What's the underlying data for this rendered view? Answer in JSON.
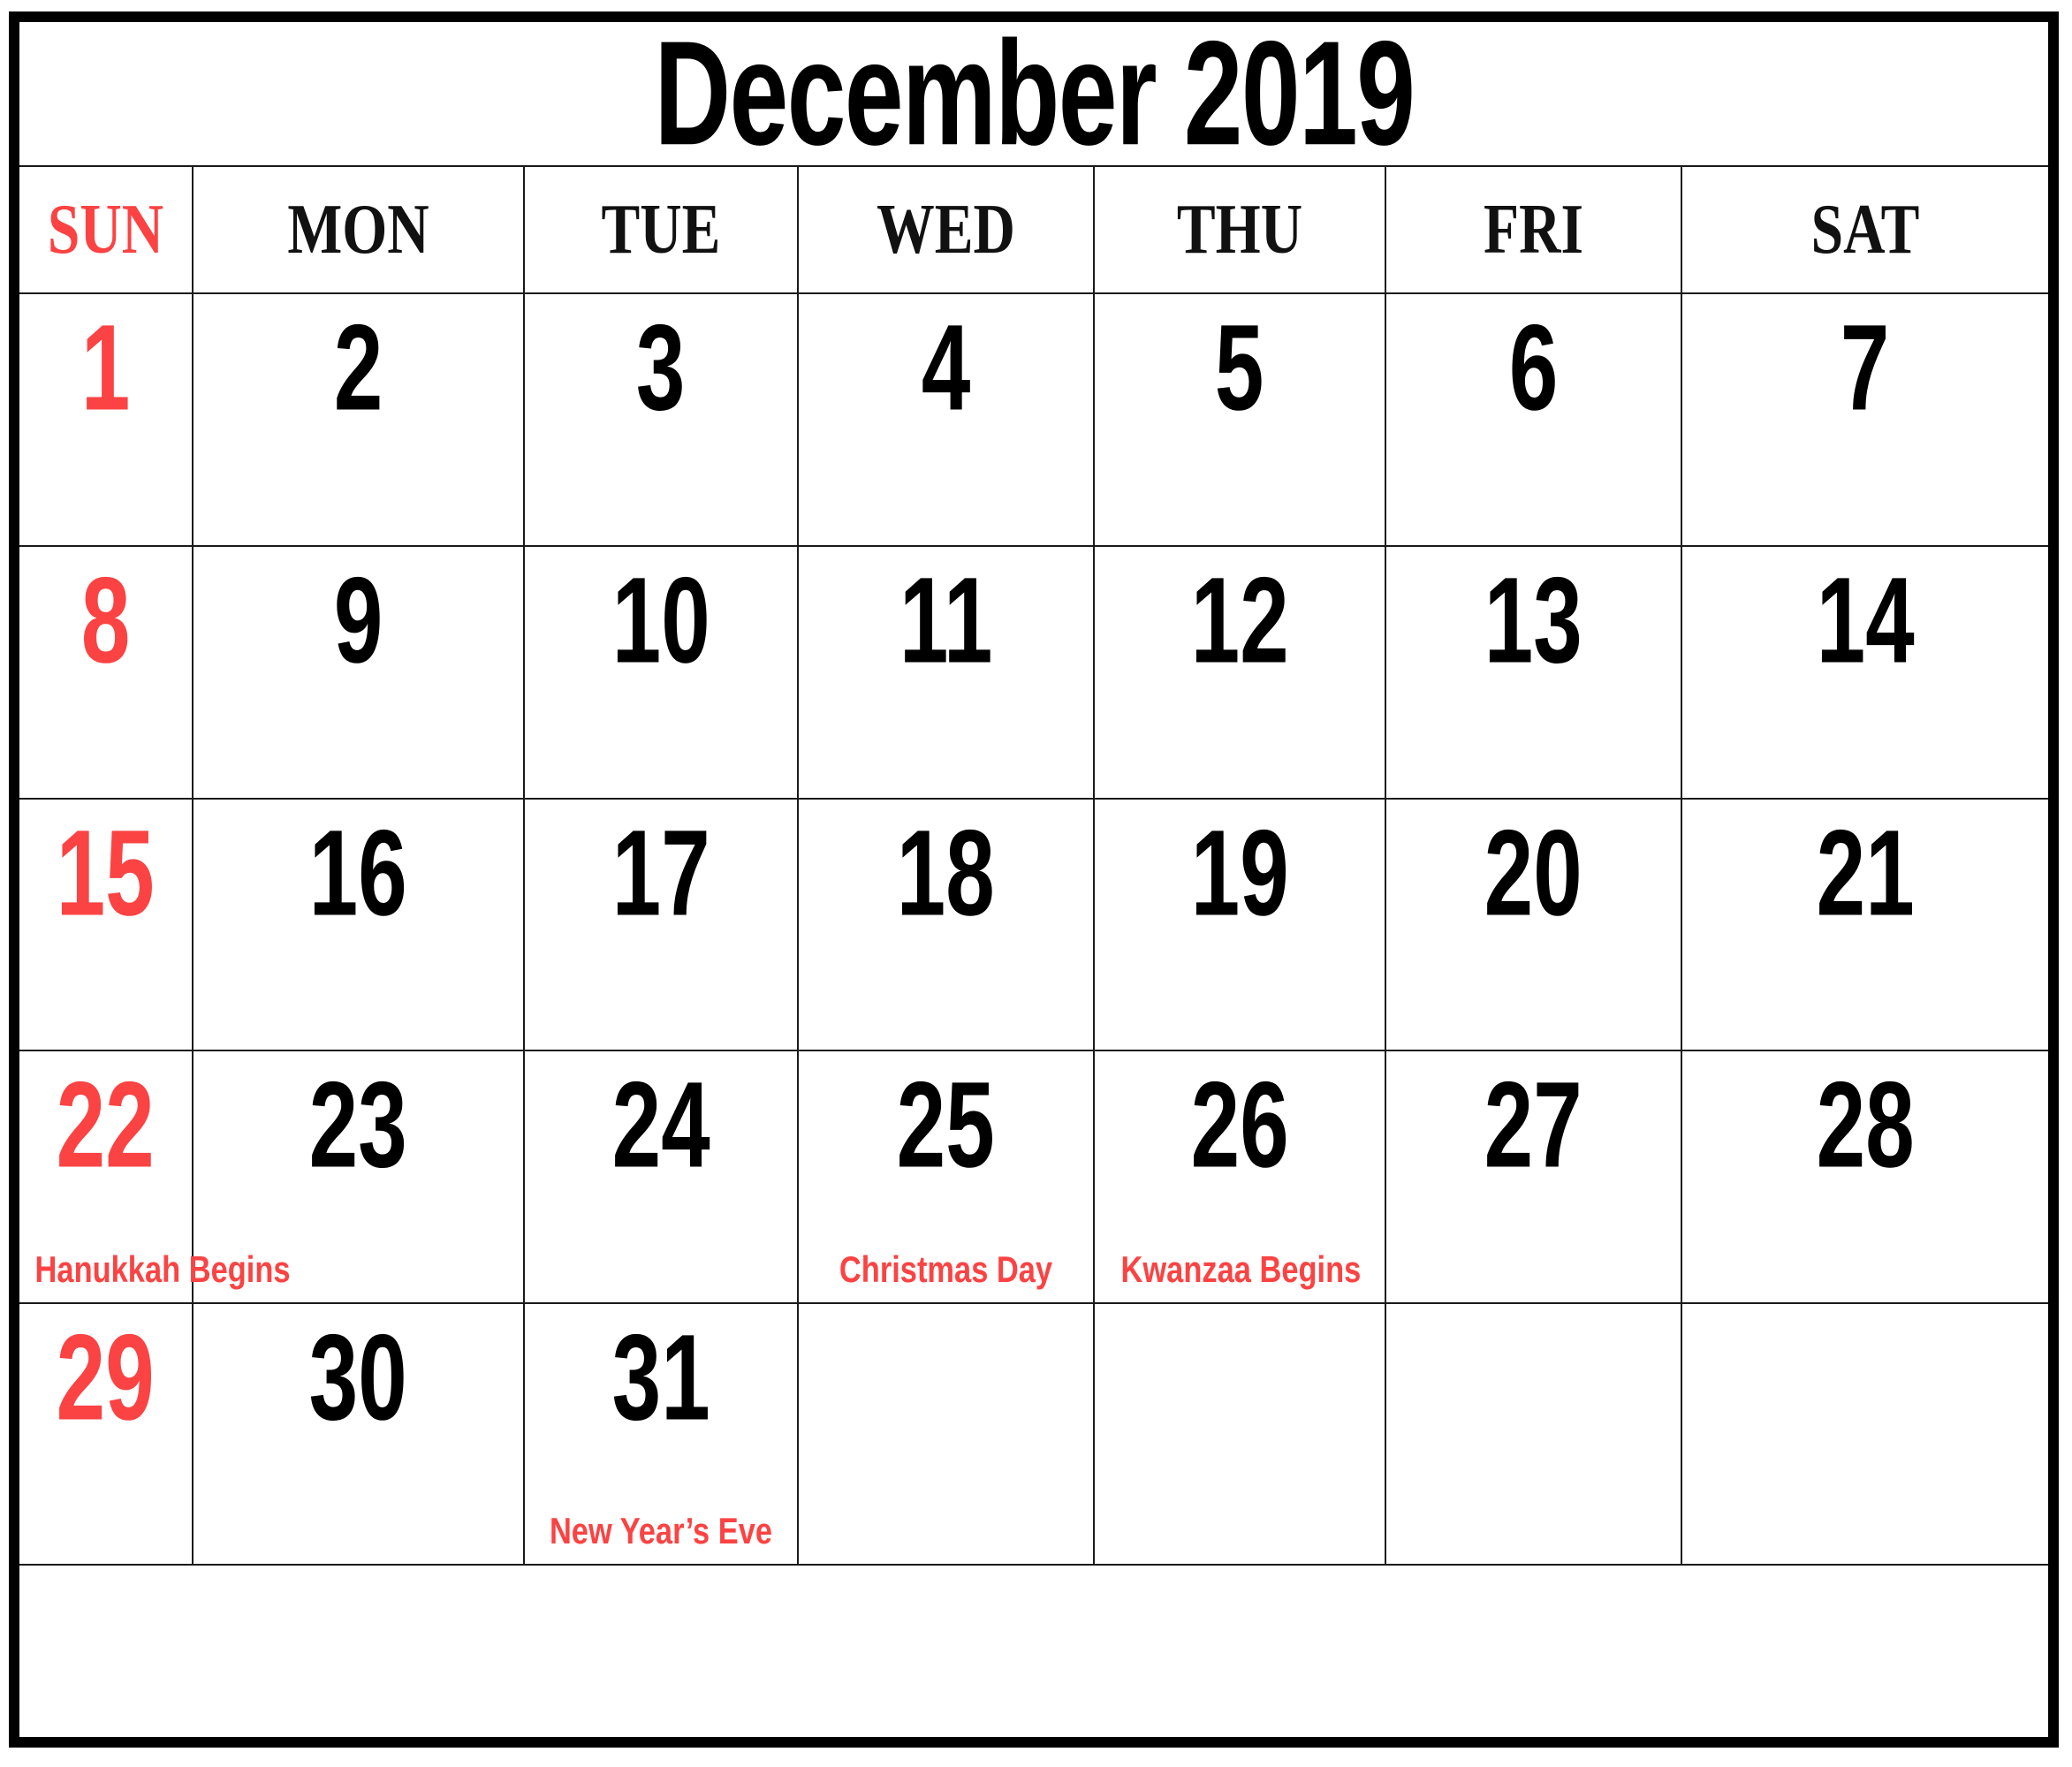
{
  "calendar": {
    "title": "December 2019",
    "accent_red": "#fb4343",
    "text_black": "#000000",
    "weekdays": [
      {
        "label": "SUN",
        "is_sunday": true
      },
      {
        "label": "MON",
        "is_sunday": false
      },
      {
        "label": "TUE",
        "is_sunday": false
      },
      {
        "label": "WED",
        "is_sunday": false
      },
      {
        "label": "THU",
        "is_sunday": false
      },
      {
        "label": "FRI",
        "is_sunday": false
      },
      {
        "label": "SAT",
        "is_sunday": false
      }
    ],
    "weeks": [
      [
        {
          "day": "1",
          "event": "",
          "is_sunday": true
        },
        {
          "day": "2",
          "event": "",
          "is_sunday": false
        },
        {
          "day": "3",
          "event": "",
          "is_sunday": false
        },
        {
          "day": "4",
          "event": "",
          "is_sunday": false
        },
        {
          "day": "5",
          "event": "",
          "is_sunday": false
        },
        {
          "day": "6",
          "event": "",
          "is_sunday": false
        },
        {
          "day": "7",
          "event": "",
          "is_sunday": false
        }
      ],
      [
        {
          "day": "8",
          "event": "",
          "is_sunday": true
        },
        {
          "day": "9",
          "event": "",
          "is_sunday": false
        },
        {
          "day": "10",
          "event": "",
          "is_sunday": false
        },
        {
          "day": "11",
          "event": "",
          "is_sunday": false
        },
        {
          "day": "12",
          "event": "",
          "is_sunday": false
        },
        {
          "day": "13",
          "event": "",
          "is_sunday": false
        },
        {
          "day": "14",
          "event": "",
          "is_sunday": false
        }
      ],
      [
        {
          "day": "15",
          "event": "",
          "is_sunday": true
        },
        {
          "day": "16",
          "event": "",
          "is_sunday": false
        },
        {
          "day": "17",
          "event": "",
          "is_sunday": false
        },
        {
          "day": "18",
          "event": "",
          "is_sunday": false
        },
        {
          "day": "19",
          "event": "",
          "is_sunday": false
        },
        {
          "day": "20",
          "event": "",
          "is_sunday": false
        },
        {
          "day": "21",
          "event": "",
          "is_sunday": false
        }
      ],
      [
        {
          "day": "22",
          "event": "Hanukkah Begins",
          "is_sunday": true
        },
        {
          "day": "23",
          "event": "",
          "is_sunday": false
        },
        {
          "day": "24",
          "event": "",
          "is_sunday": false
        },
        {
          "day": "25",
          "event": "Christmas Day",
          "is_sunday": false
        },
        {
          "day": "26",
          "event": "Kwanzaa Begins",
          "is_sunday": false
        },
        {
          "day": "27",
          "event": "",
          "is_sunday": false
        },
        {
          "day": "28",
          "event": "",
          "is_sunday": false
        }
      ],
      [
        {
          "day": "29",
          "event": "",
          "is_sunday": true
        },
        {
          "day": "30",
          "event": "",
          "is_sunday": false
        },
        {
          "day": "31",
          "event": "New Year’s Eve",
          "is_sunday": false
        },
        {
          "day": "",
          "event": "",
          "is_sunday": false
        },
        {
          "day": "",
          "event": "",
          "is_sunday": false
        },
        {
          "day": "",
          "event": "",
          "is_sunday": false
        },
        {
          "day": "",
          "event": "",
          "is_sunday": false
        }
      ]
    ]
  }
}
